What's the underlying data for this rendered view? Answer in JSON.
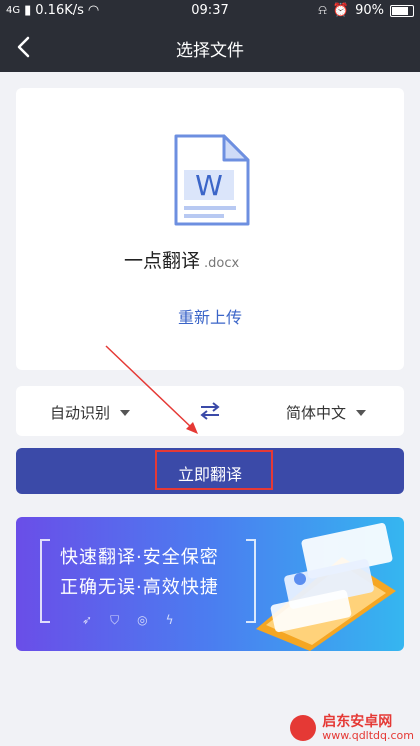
{
  "status_bar": {
    "network": "4G",
    "speed": "0.16K/s",
    "time": "09:37",
    "battery": "90%"
  },
  "nav": {
    "title": "选择文件"
  },
  "file_card": {
    "file_name": "一点翻译",
    "file_ext": ".docx",
    "doc_letter": "W",
    "reupload_label": "重新上传"
  },
  "language": {
    "source": "自动识别",
    "target": "简体中文"
  },
  "translate_button": {
    "label": "立即翻译"
  },
  "banner": {
    "line1": "快速翻译·安全保密",
    "line2": "正确无误·高效快捷"
  },
  "watermark": {
    "name": "启东安卓网",
    "url": "www.qdltdq.com"
  },
  "colors": {
    "nav_bg": "#2b2e36",
    "accent": "#3b4aa8",
    "link": "#3b65c8",
    "annotation": "#e53935"
  }
}
